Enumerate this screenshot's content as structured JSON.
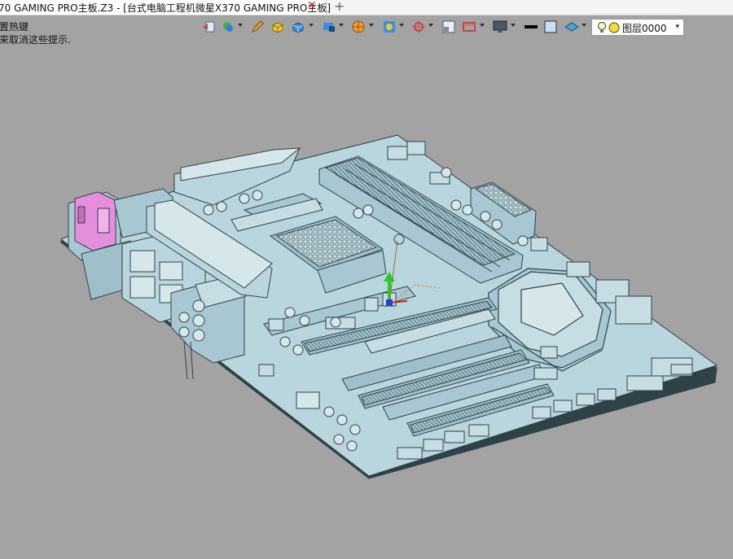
{
  "tab": {
    "title": "70 GAMING PRO主板.Z3 - [台式电脑工程机微星X370 GAMING PRO主板]",
    "close_icon": "close-icon",
    "new_tab_icon": "plus-icon",
    "close_glyph": "✕",
    "new_tab_glyph": "+"
  },
  "hint": {
    "line1": "置热键",
    "line2": "来取消这些提示."
  },
  "toolbar": {
    "icons": [
      "view-back-icon",
      "layers-icon",
      "pencil-icon",
      "yellow-cube-icon",
      "blue-cube-icon",
      "display-mode-icon",
      "render-style-icon",
      "snap-icon",
      "crosshair-icon",
      "panel-icon",
      "ruler-icon",
      "monitor-icon",
      "line-color-icon",
      "fill-color-icon",
      "workplane-icon"
    ],
    "layer": {
      "label": "图层0000",
      "caret": "▾",
      "icons": [
        "lightbulb-icon",
        "layer-color-icon"
      ]
    }
  },
  "colors": {
    "board": "#b9d5de",
    "board_edge": "#2f4247",
    "background": "#a3a3a3",
    "io_pink": "#e58fdc"
  }
}
